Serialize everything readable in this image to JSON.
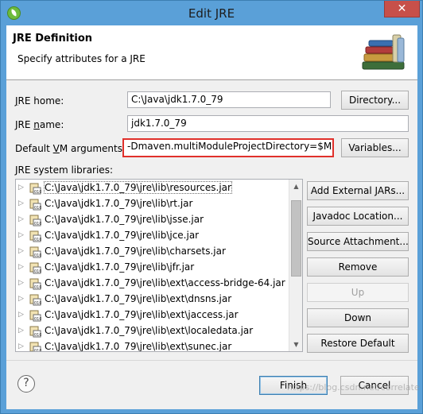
{
  "window": {
    "title": "Edit JRE",
    "close_label": "✕"
  },
  "header": {
    "title": "JRE Definition",
    "description": "Specify attributes for a JRE"
  },
  "form": {
    "jre_home_label": "JRE home:",
    "jre_home_value": "C:\\Java\\jdk1.7.0_79",
    "directory_button": "Directory...",
    "jre_name_label": "JRE name:",
    "jre_name_value": "jdk1.7.0_79",
    "vm_args_label": "Default VM arguments:",
    "vm_args_value": "-Dmaven.multiModuleProjectDirectory=$M",
    "variables_button": "Variables...",
    "libraries_label": "JRE system libraries:"
  },
  "libraries": [
    "C:\\Java\\jdk1.7.0_79\\jre\\lib\\resources.jar",
    "C:\\Java\\jdk1.7.0_79\\jre\\lib\\rt.jar",
    "C:\\Java\\jdk1.7.0_79\\jre\\lib\\jsse.jar",
    "C:\\Java\\jdk1.7.0_79\\jre\\lib\\jce.jar",
    "C:\\Java\\jdk1.7.0_79\\jre\\lib\\charsets.jar",
    "C:\\Java\\jdk1.7.0_79\\jre\\lib\\jfr.jar",
    "C:\\Java\\jdk1.7.0_79\\jre\\lib\\ext\\access-bridge-64.jar",
    "C:\\Java\\jdk1.7.0_79\\jre\\lib\\ext\\dnsns.jar",
    "C:\\Java\\jdk1.7.0_79\\jre\\lib\\ext\\jaccess.jar",
    "C:\\Java\\jdk1.7.0_79\\jre\\lib\\ext\\localedata.jar",
    "C:\\Java\\jdk1.7.0_79\\jre\\lib\\ext\\sunec.jar"
  ],
  "side_buttons": {
    "add_external": "Add External JARs...",
    "javadoc": "Javadoc Location...",
    "source": "Source Attachment...",
    "remove": "Remove",
    "up": "Up",
    "down": "Down",
    "restore": "Restore Default"
  },
  "footer": {
    "help": "?",
    "finish": "Finish",
    "cancel": "Cancel"
  },
  "watermark": "https://blog.csdn.net/correlate",
  "colors": {
    "titlebar": "#5aa0d8",
    "highlight_border": "#e0302b",
    "close": "#c7504a"
  }
}
